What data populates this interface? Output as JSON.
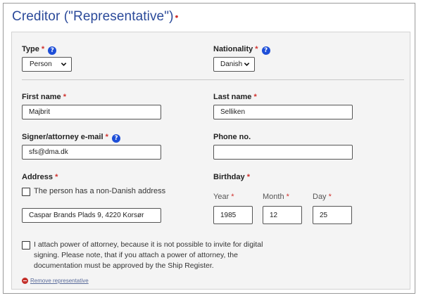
{
  "section": {
    "title": "Creditor (\"Representative\")",
    "required_mark": "•"
  },
  "required_star": "*",
  "help_glyph": "?",
  "type": {
    "label": "Type",
    "value": "Person"
  },
  "nationality": {
    "label": "Nationality",
    "value": "Danish"
  },
  "first_name": {
    "label": "First name",
    "value": "Majbrit"
  },
  "last_name": {
    "label": "Last name",
    "value": "Selliken"
  },
  "email": {
    "label": "Signer/attorney e-mail",
    "value": "sfs@dma.dk"
  },
  "phone": {
    "label": "Phone no.",
    "value": ""
  },
  "address": {
    "label": "Address",
    "non_danish_label": "The person has a non-Danish address",
    "value": "Caspar Brands Plads 9, 4220 Korsør"
  },
  "birthday": {
    "label": "Birthday",
    "year_label": "Year",
    "month_label": "Month",
    "day_label": "Day",
    "year": "1985",
    "month": "12",
    "day": "25"
  },
  "attach_poa": {
    "line1": "I attach power of attorney, because it is not possible to invite for digital",
    "line2": "signing. Please note, that if you attach a power of attorney, the",
    "line3": "documentation must be approved by the Ship Register."
  },
  "remove_label": "Remove representative",
  "colors": {
    "title": "#2b4a9a",
    "required": "#d0312d",
    "help_icon": "#1d4ed8",
    "panel": "#f4f4f4",
    "remove_icon": "#c4302b"
  }
}
